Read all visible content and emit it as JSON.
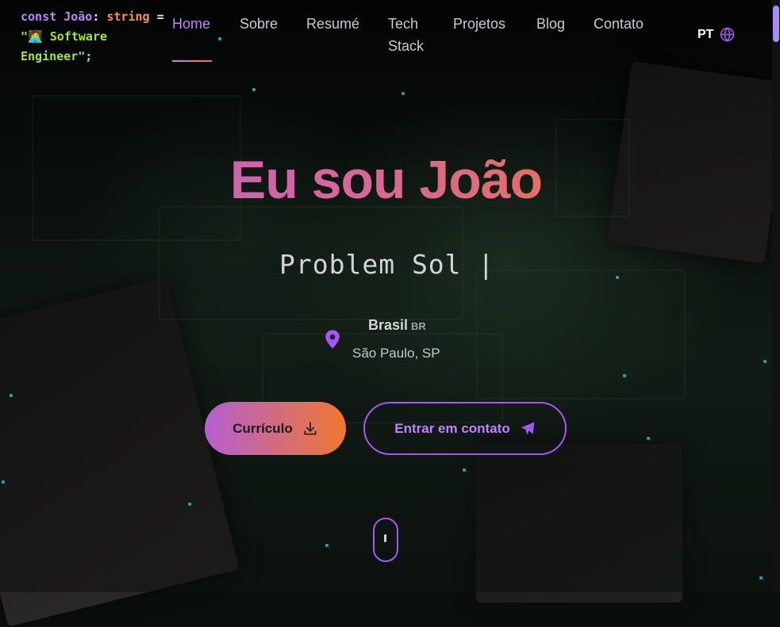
{
  "logo": {
    "kw_const": "const",
    "name": "João",
    "colon": ":",
    "type": "string",
    "eq": "=",
    "quote_open": "\"",
    "emoji": "🧑‍💻",
    "role": "Software Engineer\";"
  },
  "nav": {
    "items": [
      {
        "label": "Home"
      },
      {
        "label": "Sobre"
      },
      {
        "label": "Resumé"
      },
      {
        "label": "Tech"
      },
      {
        "label": "Stack"
      },
      {
        "label": "Projetos"
      },
      {
        "label": "Blog"
      },
      {
        "label": "Contato"
      }
    ],
    "active": "Home",
    "language": "PT",
    "language_icon": "globe-icon"
  },
  "hero": {
    "title": "Eu sou João",
    "typed_text": "Problem Sol |",
    "location": {
      "icon": "map-pin-icon",
      "country": "Brasil",
      "flag_code": "BR",
      "city": "São Paulo, SP"
    },
    "cv_button": {
      "label": "Currículo",
      "icon": "download-icon"
    },
    "contact_button": {
      "label": "Entrar em contato",
      "icon": "paper-plane-icon"
    },
    "scroll_indicator_icon": "mouse-scroll-icon"
  },
  "colors": {
    "accent_purple": "#a855f7",
    "accent_orange": "#f0782f",
    "particles": "#22d3ee"
  }
}
